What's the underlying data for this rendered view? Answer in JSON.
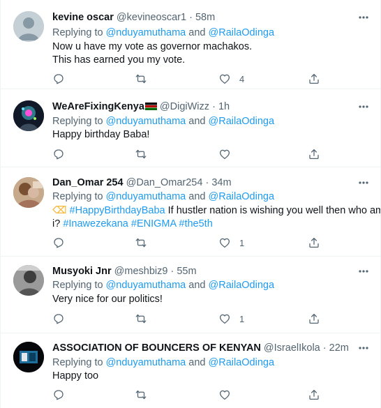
{
  "tweets": [
    {
      "name": "kevine oscar",
      "badge": "",
      "handle": "@kevineoscar1",
      "time": "58m",
      "replying_label": "Replying to",
      "mention1": "@nduyamuthama",
      "and": "and",
      "mention2": "@RailaOdinga",
      "text_line1": "Now u have my vote as governor machakos.",
      "text_line2": "This has earned you my vote.",
      "likes": "4",
      "avatar": "default-person-avatar"
    },
    {
      "name": "WeAreFixingKenya",
      "badge": "kenya-flag-emoji",
      "handle": "@DigiWizz",
      "time": "1h",
      "replying_label": "Replying to",
      "mention1": "@nduyamuthama",
      "and": "and",
      "mention2": "@RailaOdinga",
      "text_line1": "Happy birthday Baba!",
      "likes": "",
      "avatar": "photo-avatar"
    },
    {
      "name": "Dan_Omar 254",
      "badge": "",
      "handle": "@Dan_Omar254",
      "time": "34m",
      "replying_label": "Replying to",
      "mention1": "@nduyamuthama",
      "and": "and",
      "mention2": "@RailaOdinga",
      "emoji": "flexed-biceps-emoji",
      "hashtag1": "#HappyBirthdayBaba",
      "text_mid": " If hustler nation is wishing you well then who am",
      "text_line2_start": "i? ",
      "hashtag2": "#Inawezekana",
      "hashtag3": "#ENIGMA",
      "hashtag4": "#the5th",
      "likes": "1",
      "avatar": "photo-avatar"
    },
    {
      "name": "Musyoki Jnr",
      "badge": "",
      "handle": "@meshbiz9",
      "time": "55m",
      "replying_label": "Replying to",
      "mention1": "@nduyamuthama",
      "and": "and",
      "mention2": "@RailaOdinga",
      "text_line1": "Very nice for our politics!",
      "likes": "1",
      "avatar": "photo-avatar"
    },
    {
      "name": "ASSOCIATION OF BOUNCERS OF KENYAN",
      "badge": "",
      "handle": "@IsraelIkola",
      "time": "22m",
      "replying_label": "Replying to",
      "mention1": "@nduyamuthama",
      "and": "and",
      "mention2": "@RailaOdinga",
      "text_line1": "Happy too",
      "likes": "",
      "avatar": "photo-avatar"
    }
  ],
  "separator": "·",
  "colors": {
    "link": "#1d9bf0",
    "muted": "#536471",
    "text": "#0f1419",
    "border": "#eff3f4"
  }
}
